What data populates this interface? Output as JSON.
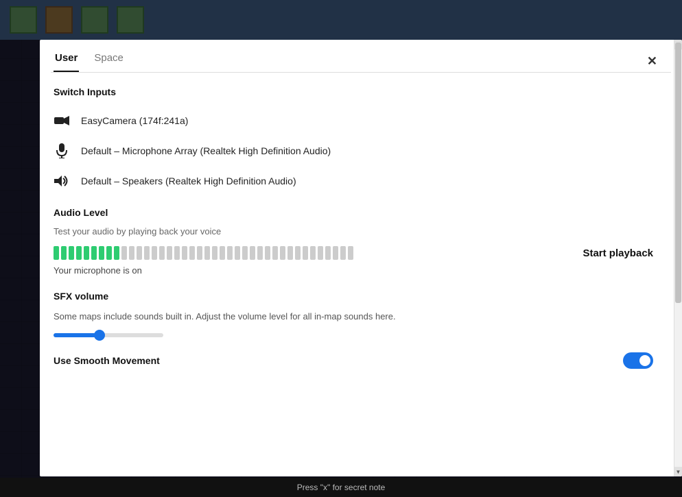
{
  "background": {
    "color": "#2d3a5e"
  },
  "modal": {
    "tabs": [
      {
        "label": "User",
        "active": true
      },
      {
        "label": "Space",
        "active": false
      }
    ],
    "close_label": "✕",
    "sections": {
      "switch_inputs": {
        "title": "Switch Inputs",
        "devices": [
          {
            "id": "camera",
            "icon": "camera",
            "label": "EasyCamera (174f:241a)"
          },
          {
            "id": "microphone",
            "icon": "microphone",
            "label": "Default – Microphone Array (Realtek High Definition Audio)"
          },
          {
            "id": "speaker",
            "icon": "speaker",
            "label": "Default – Speakers (Realtek High Definition Audio)"
          }
        ]
      },
      "audio_level": {
        "title": "Audio Level",
        "description": "Test your audio by playing back your voice",
        "start_playback_label": "Start playback",
        "mic_status": "Your microphone is on",
        "active_bars": 9,
        "total_bars": 40
      },
      "sfx_volume": {
        "title": "SFX volume",
        "description": "Some maps include sounds built in. Adjust the volume level for all in-map sounds here.",
        "volume_percent": 42
      },
      "smooth_movement": {
        "title": "Use Smooth Movement",
        "enabled": true
      }
    }
  },
  "bottom_bar": {
    "text": "Press \"x\" for secret note"
  }
}
